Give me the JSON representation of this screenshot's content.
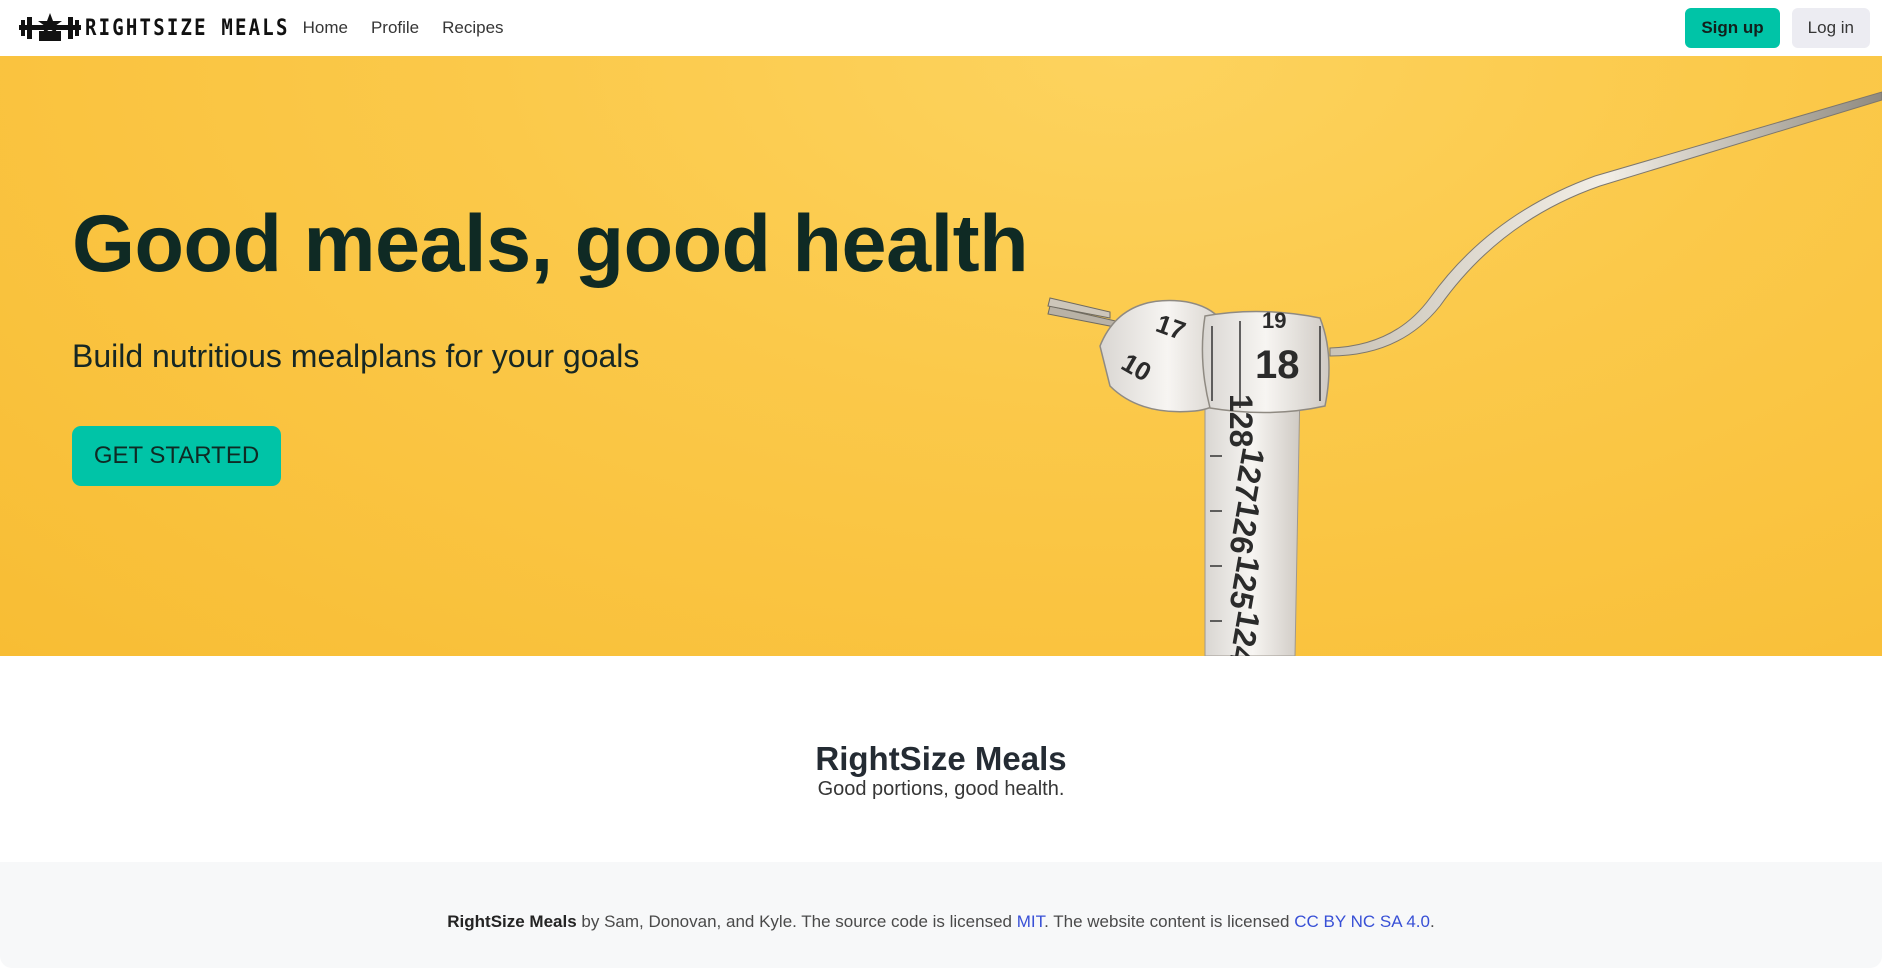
{
  "navbar": {
    "brand_name": "RIGHTSIZE MEALS",
    "links": [
      "Home",
      "Profile",
      "Recipes"
    ],
    "signup_label": "Sign up",
    "login_label": "Log in"
  },
  "hero": {
    "title": "Good meals, good health",
    "subtitle": "Build nutritious mealplans for your goals",
    "cta_label": "GET STARTED",
    "tape_numbers": [
      "19",
      "18",
      "17",
      "10",
      "128",
      "127",
      "126",
      "125",
      "124"
    ]
  },
  "about": {
    "title": "RightSize Meals",
    "tagline": "Good portions, good health."
  },
  "footer": {
    "site_name": "RightSize Meals",
    "authors_text": " by Sam, Donovan, and Kyle. The source code is licensed ",
    "code_license": "MIT",
    "content_text": ". The website content is licensed ",
    "content_license": "CC BY NC SA 4.0",
    "end_text": "."
  },
  "colors": {
    "accent": "#00c4a7",
    "hero_background": "#fbc94a",
    "link": "#3850d6",
    "footer_background": "#f7f8f9"
  }
}
